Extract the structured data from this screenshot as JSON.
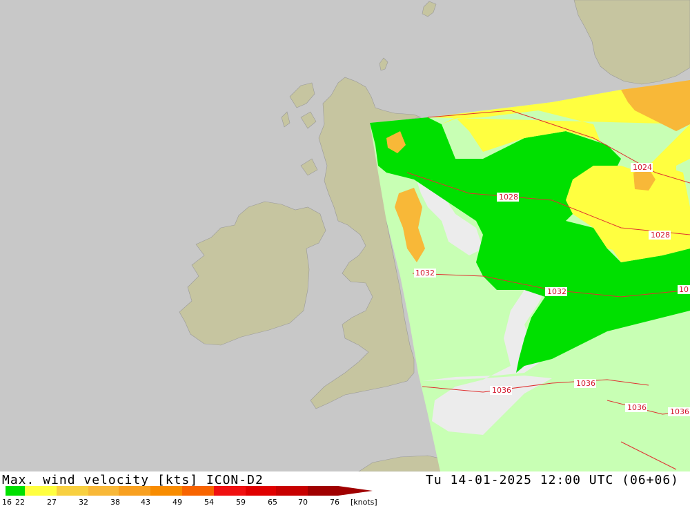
{
  "title_left": "Max. wind velocity [kts] ICON-D2",
  "title_right": "Tu 14-01-2025 12:00 UTC (06+06)",
  "legend": {
    "unit": "[knots]",
    "bins": [
      {
        "label": "16",
        "color": "#00e000"
      },
      {
        "label": "22",
        "color": "#00e000"
      },
      {
        "label": "27",
        "color": "#ffff40"
      },
      {
        "label": "32",
        "color": "#f8d040"
      },
      {
        "label": "38",
        "color": "#f8b838"
      },
      {
        "label": "43",
        "color": "#f8a020"
      },
      {
        "label": "49",
        "color": "#f88c00"
      },
      {
        "label": "54",
        "color": "#f86400"
      },
      {
        "label": "59",
        "color": "#f01010"
      },
      {
        "label": "65",
        "color": "#e00000"
      },
      {
        "label": "70",
        "color": "#c80000"
      },
      {
        "label": "76",
        "color": "#a00000"
      }
    ]
  },
  "isobars": [
    "1024",
    "1028",
    "1028",
    "1032",
    "1032",
    "1036",
    "1036",
    "1036",
    "1036"
  ],
  "isobar_partial": "10",
  "colors": {
    "sea": "#c8c8c8",
    "land_outside": "#c6c5a0",
    "weak_wind": "#c8ffb4",
    "calm": "#ececec",
    "green": "#00e000",
    "yellow": "#ffff40",
    "isobar": "#e03030"
  }
}
